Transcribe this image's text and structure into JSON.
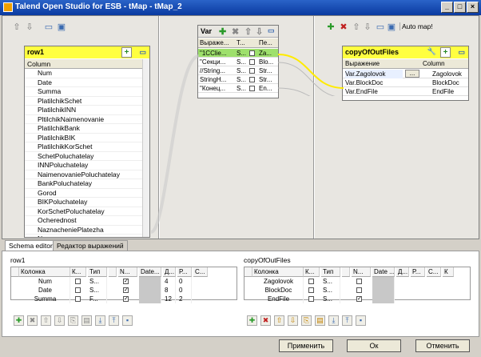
{
  "window": {
    "title": "Talend Open Studio for ESB - tMap - tMap_2"
  },
  "row1": {
    "title": "row1",
    "column_header": "Column",
    "columns": [
      "Num",
      "Date",
      "Summa",
      "PlatilchikSchet",
      "PlatilchikINN",
      "PltilchikNaimenovanie",
      "PlatilchikBank",
      "PlatilchikBIK",
      "PlatilchikKorSchet",
      "SchetPoluchatelay",
      "INNPoluchatelay",
      "NaimenovaniePoluchatelay",
      "BankPoluchatelay",
      "Gorod",
      "BIKPoluchatelay",
      "KorSchetPoluchatelay",
      "Ocherednost",
      "NaznacheniePlatezha",
      "Nazn..."
    ]
  },
  "var": {
    "title": "Var",
    "headers": [
      "Выраже...",
      "T...",
      "Пе..."
    ],
    "rows": [
      {
        "expr": "\"1CClie...",
        "type": "S...",
        "name": "Za..."
      },
      {
        "expr": "\"Секци...",
        "type": "S...",
        "name": "Blo..."
      },
      {
        "expr": "//String...",
        "type": "S...",
        "name": "Str..."
      },
      {
        "expr": "StringH...",
        "type": "S...",
        "name": "Str..."
      },
      {
        "expr": "\"Конец...",
        "type": "S...",
        "name": "En..."
      }
    ]
  },
  "output": {
    "auto_map": "Auto map!",
    "title": "copyOfOutFiles",
    "headers": [
      "Выражение",
      "Column"
    ],
    "rows": [
      {
        "expr": "Var.Zagolovok",
        "col": "Zagolovok",
        "btn": "..."
      },
      {
        "expr": "Var.BlockDoc",
        "col": "BlockDoc"
      },
      {
        "expr": "Var.EndFile",
        "col": "EndFile"
      }
    ]
  },
  "tabs": [
    "Schema editor",
    "Редактор выражений"
  ],
  "schema_left": {
    "title": "row1",
    "headers": [
      "Колонка",
      "К...",
      "Тип",
      "",
      "N...",
      "Date...",
      "Д...",
      "Р...",
      "C..."
    ],
    "rows": [
      {
        "name": "Num",
        "type": "S...",
        "len": "4",
        "prec": "0"
      },
      {
        "name": "Date",
        "type": "S...",
        "len": "8",
        "prec": "0"
      },
      {
        "name": "Summa",
        "type": "F...",
        "len": "12",
        "prec": "2"
      }
    ]
  },
  "schema_right": {
    "title": "copyOfOutFiles",
    "headers": [
      "Колонка",
      "К...",
      "Тип",
      "",
      "N...",
      "Date ...",
      "Д...",
      "Р...",
      "C...",
      "К"
    ],
    "rows": [
      {
        "name": "Zagolovok",
        "type": "S..."
      },
      {
        "name": "BlockDoc",
        "type": "S..."
      },
      {
        "name": "EndFile",
        "type": "S..."
      }
    ]
  },
  "buttons": {
    "apply": "Применить",
    "ok": "Ок",
    "cancel": "Отменить"
  }
}
